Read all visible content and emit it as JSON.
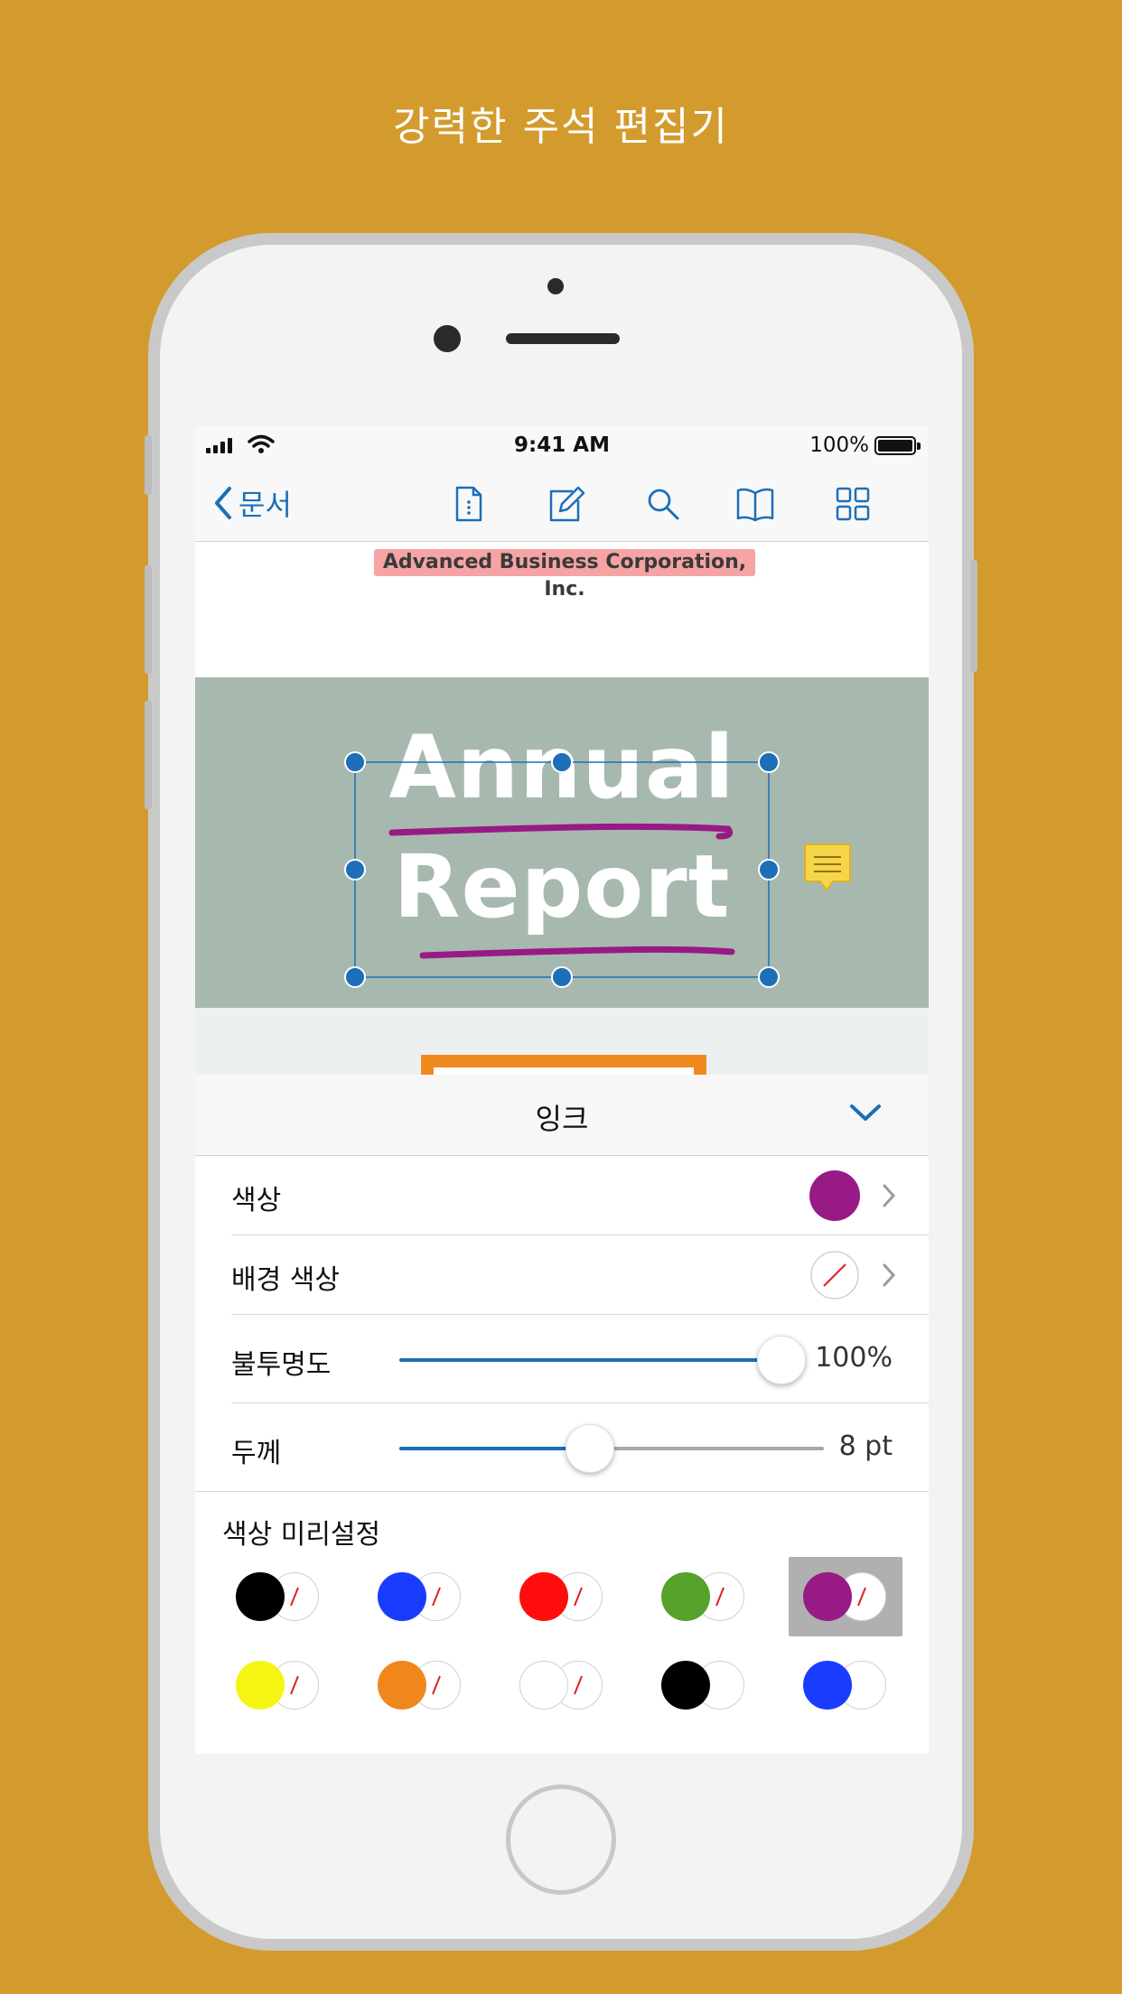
{
  "headline": "강력한 주석 편집기",
  "status_bar": {
    "time": "9:41 AM",
    "battery": "100%"
  },
  "nav": {
    "back_label": "문서"
  },
  "document": {
    "company": "Advanced Business Corporation, Inc.",
    "title_line1": "Annual",
    "title_line2": "Report"
  },
  "panel": {
    "title": "잉크",
    "rows": {
      "color": {
        "label": "색상",
        "value_color": "#981A84"
      },
      "bg_color": {
        "label": "배경 색상"
      },
      "opacity": {
        "label": "불투명도",
        "value": "100%",
        "level": 1.0
      },
      "thickness": {
        "label": "두께",
        "value": "8 pt",
        "level": 0.45
      }
    },
    "presets_label": "색상 미리설정",
    "presets": [
      {
        "color": "#000000",
        "bg": "none"
      },
      {
        "color": "#1A3CFF",
        "bg": "none"
      },
      {
        "color": "#FF0D0D",
        "bg": "none"
      },
      {
        "color": "#57A22A",
        "bg": "none"
      },
      {
        "color": "#981A84",
        "bg": "none",
        "selected": true
      },
      {
        "color": "#F5F514",
        "bg": "none"
      },
      {
        "color": "#F0871C",
        "bg": "none"
      },
      {
        "color": "#FFFFFF",
        "bg": "none"
      },
      {
        "color": "#000000",
        "bg": "white"
      },
      {
        "color": "#1A3CFF",
        "bg": "white"
      }
    ]
  },
  "colors": {
    "accent": "#1C6FB8",
    "ink": "#981A84",
    "background": "#D39B2E"
  }
}
